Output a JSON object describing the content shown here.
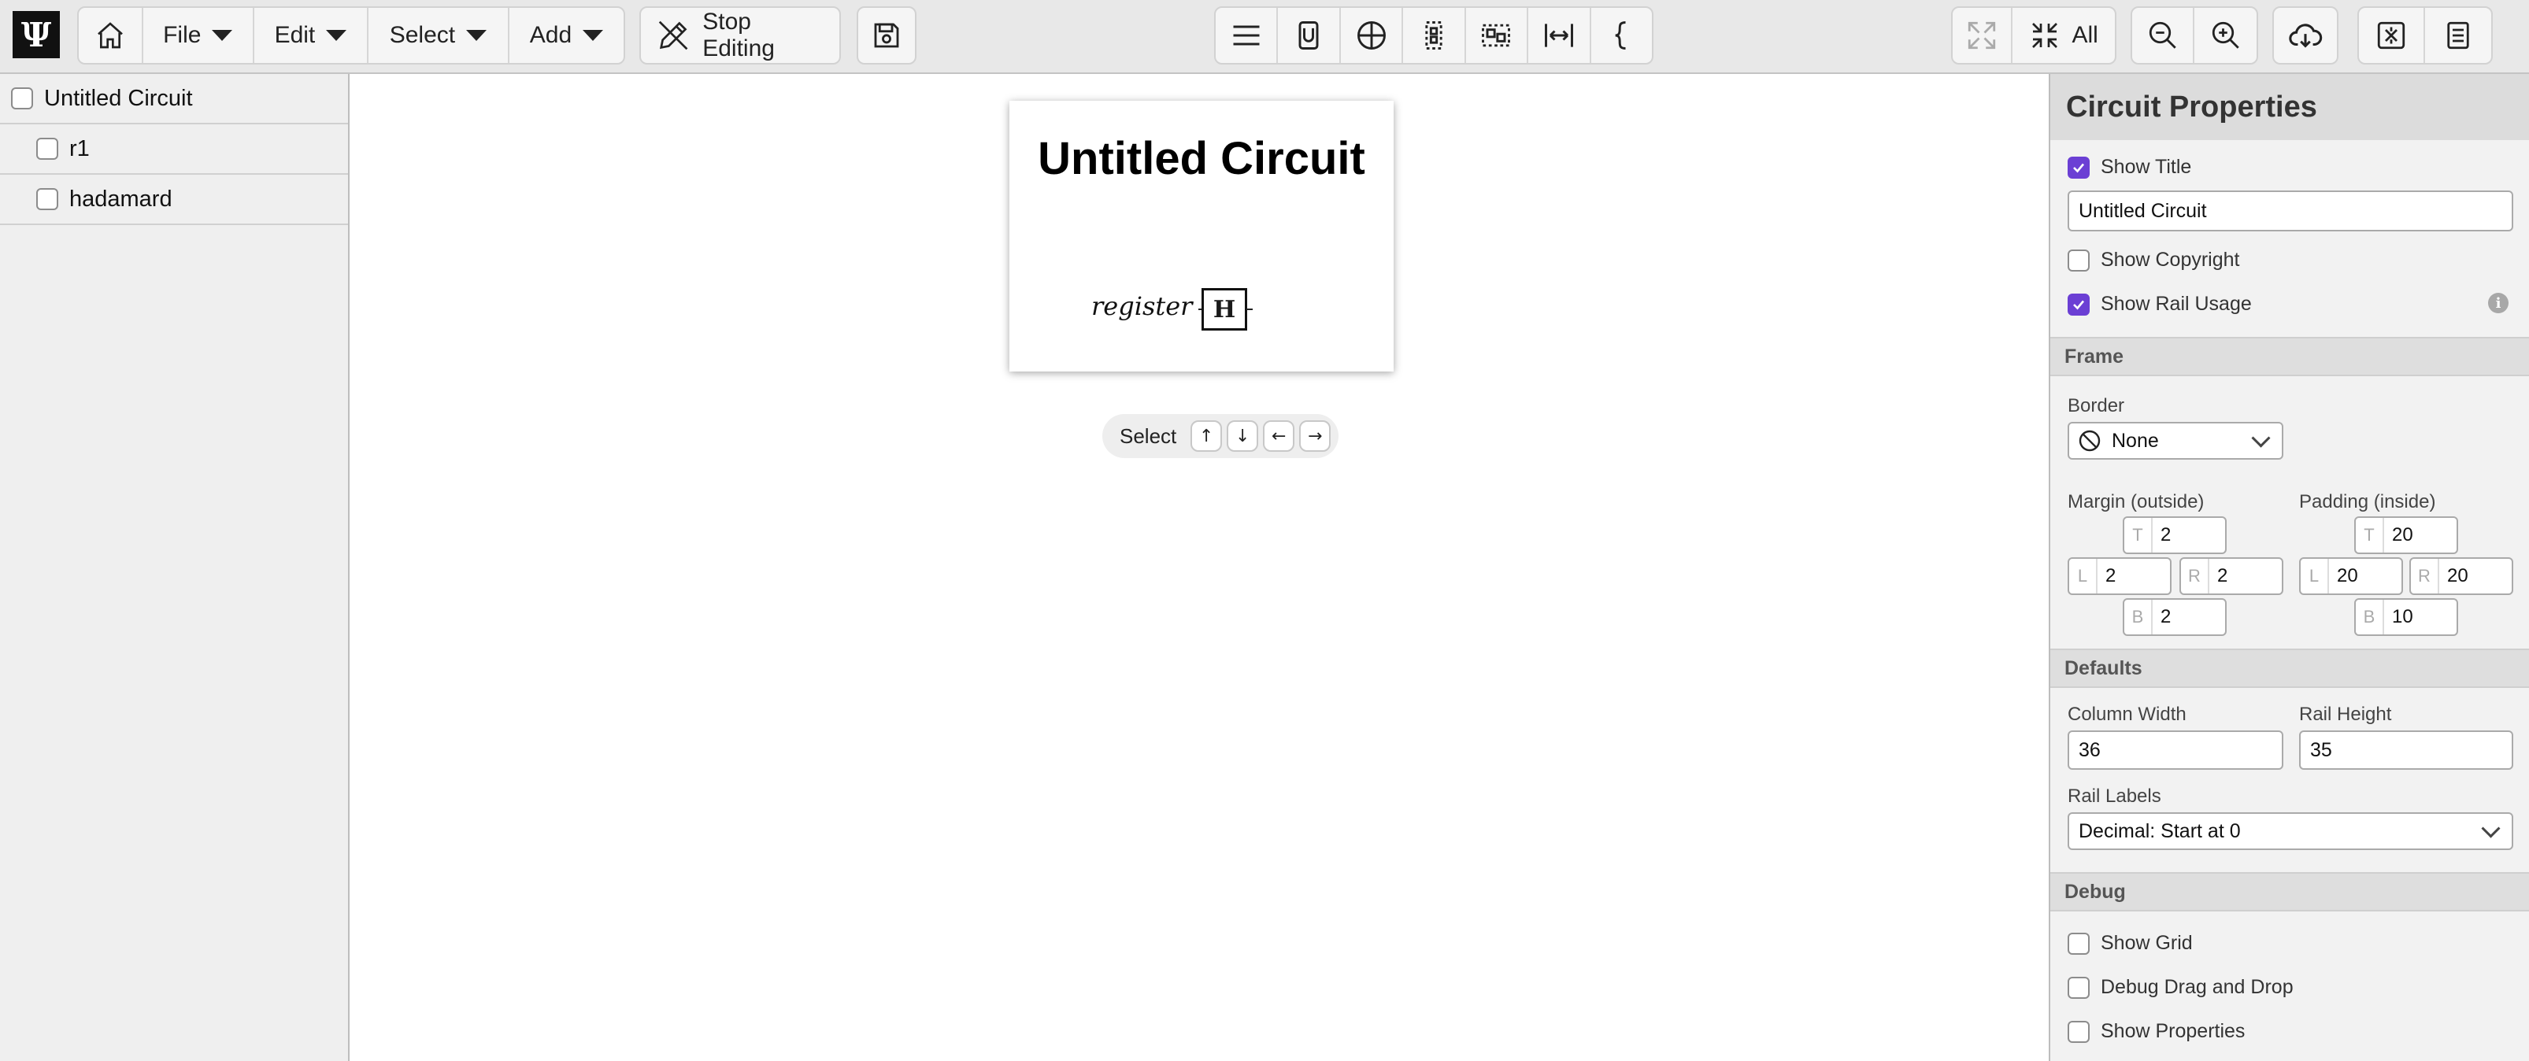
{
  "toolbar": {
    "logo": "Ψ",
    "file_label": "File",
    "edit_label": "Edit",
    "select_label": "Select",
    "add_label": "Add",
    "stop_editing_label": "Stop Editing",
    "all_label": "All"
  },
  "sidebar": {
    "items": [
      {
        "label": "Untitled Circuit"
      },
      {
        "label": "r1"
      },
      {
        "label": "hadamard"
      }
    ]
  },
  "circuit": {
    "title": "Untitled Circuit",
    "register_label": "register",
    "gate_label": "H"
  },
  "select_nav": {
    "label": "Select",
    "up": "↑",
    "down": "↓",
    "left": "←",
    "right": "→"
  },
  "panel": {
    "title": "Circuit Properties",
    "show_title_label": "Show Title",
    "show_title_checked": true,
    "title_value": "Untitled Circuit",
    "show_copyright_label": "Show Copyright",
    "show_copyright_checked": false,
    "show_rail_usage_label": "Show Rail Usage",
    "show_rail_usage_checked": true,
    "frame": {
      "heading": "Frame",
      "border_label": "Border",
      "border_value": "None",
      "margin_label": "Margin (outside)",
      "margin": {
        "T": "2",
        "L": "2",
        "R": "2",
        "B": "2"
      },
      "padding_label": "Padding (inside)",
      "padding": {
        "T": "20",
        "L": "20",
        "R": "20",
        "B": "10"
      }
    },
    "defaults": {
      "heading": "Defaults",
      "column_width_label": "Column Width",
      "column_width_value": "36",
      "rail_height_label": "Rail Height",
      "rail_height_value": "35",
      "rail_labels_label": "Rail Labels",
      "rail_labels_value": "Decimal: Start at 0"
    },
    "debug": {
      "heading": "Debug",
      "show_grid_label": "Show Grid",
      "debug_dnd_label": "Debug Drag and Drop",
      "show_properties_label": "Show Properties"
    }
  },
  "colors": {
    "accent": "#6b3fd4",
    "toolbar_bg": "#e8e8e8"
  }
}
